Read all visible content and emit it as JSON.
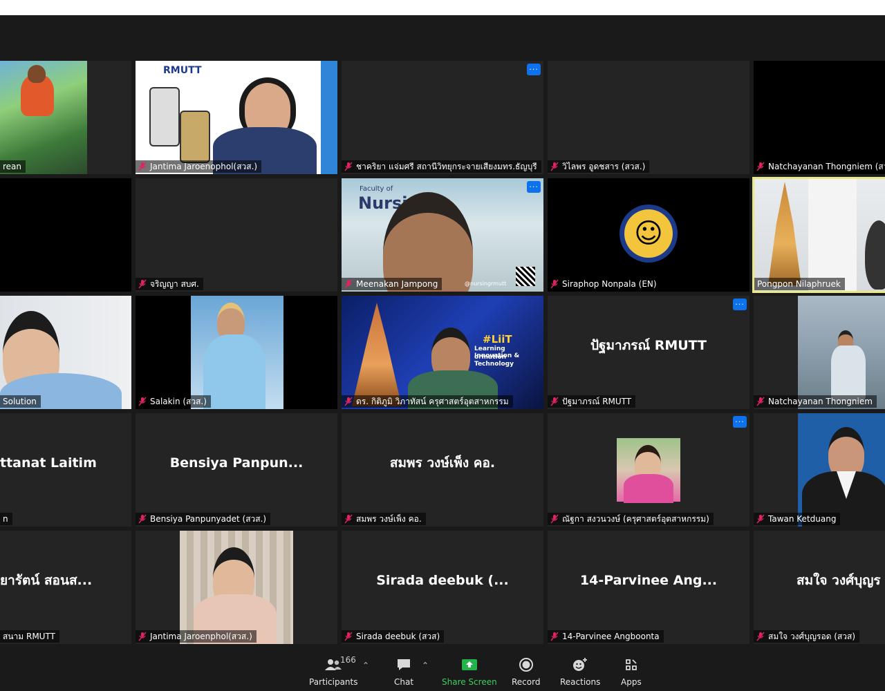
{
  "participants": [
    {
      "label": "rean",
      "big": ""
    },
    {
      "label": "Jantima Jaroenophol(สวส.)",
      "big": ""
    },
    {
      "label": "ชาคริยา แจ่มศรี สถานีวิทยุกระจายเสียงมทร.ธัญบุรี",
      "big": ""
    },
    {
      "label": "วิไลพร  อูดชสาร (สวส.)",
      "big": ""
    },
    {
      "label": "Natchayanan Thongniem (สวส.",
      "big": ""
    },
    {
      "label": "",
      "big": ""
    },
    {
      "label": "จริญญา สบศ.",
      "big": ""
    },
    {
      "label": "Meenakan Jampong",
      "big": ""
    },
    {
      "label": "Siraphop Nonpala (EN)",
      "big": ""
    },
    {
      "label": "Pongpon Nilaphruek",
      "big": ""
    },
    {
      "label": "Solution",
      "big": ""
    },
    {
      "label": "Salakin  (สวส.)",
      "big": ""
    },
    {
      "label": "ดร. กิติภูมิ วิภาทัสน์ ครุศาสตร์อุตสาหกรรม",
      "big": ""
    },
    {
      "label": "ปัฐมาภรณ์ RMUTT",
      "big": "ปัฐมาภรณ์ RMUTT"
    },
    {
      "label": "Natchayanan Thongniem",
      "big": ""
    },
    {
      "label": "n",
      "big": "ttanat Laitim"
    },
    {
      "label": "Bensiya Panpunyadet (สวส.)",
      "big": "Bensiya  Panpun..."
    },
    {
      "label": "สมพร วงษ์เพ็ง คอ.",
      "big": "สมพร วงษ์เพ็ง คอ."
    },
    {
      "label": "ณัฐกา สงวนวงษ์ (ครุศาสตร์อุตสาหกรรม)",
      "big": ""
    },
    {
      "label": "Tawan Ketduang",
      "big": ""
    },
    {
      "label": "สนาม RMUTT",
      "big": "ยารัตน์ สอนส..."
    },
    {
      "label": "Jantima Jaroenphol(สวส.)",
      "big": ""
    },
    {
      "label": "Sirada deebuk (สวส)",
      "big": "Sirada deebuk (..."
    },
    {
      "label": "14-Parvinee Angboonta",
      "big": "14-Parvinee Ang..."
    },
    {
      "label": "สมใจ วงศ์บุญรอด (สวส)",
      "big": "สมใจ วงศ์บุญร"
    }
  ],
  "video_text": {
    "rmutt_logo": "RMUTT",
    "faculty_of": "Faculty of",
    "nursi": "Nursi",
    "nursing_handle": "@nursingrmutt",
    "liit": "#LiiT",
    "liit_sub1": "Learning Innovation &",
    "liit_sub2": "ormation Technology"
  },
  "toolbar": {
    "participants_label": "Participants",
    "participants_count": "166",
    "chat_label": "Chat",
    "share_label": "Share Screen",
    "record_label": "Record",
    "reactions_label": "Reactions",
    "apps_label": "Apps"
  },
  "colors": {
    "accent": "#0e72ed",
    "share": "#3fcf5e",
    "muted_mic": "#e0245e",
    "active_speaker": "#e8e88a"
  }
}
